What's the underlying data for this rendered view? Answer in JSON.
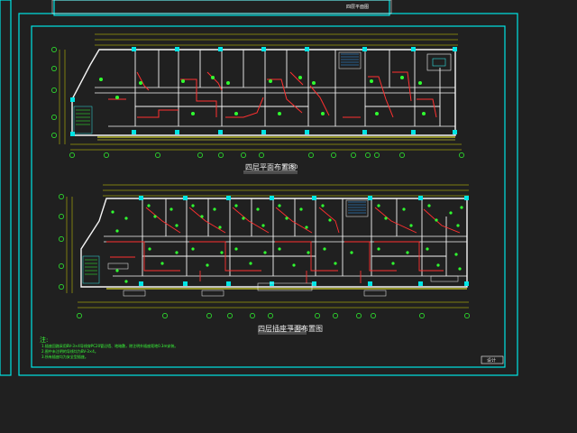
{
  "drawing": {
    "plan_upper_title": "四层平面布置图",
    "plan_upper_scale": "1:150",
    "plan_lower_title": "四层插座平面布置图",
    "plan_lower_scale": "1:150",
    "notes_heading": "注:",
    "notes_lines": [
      "1.插座回路采用BV-3×4导线穿PC20管沿墙、地暗敷，除注明外插座距地0.3m安装。",
      "2.图中未注明的导线均为BV-3×4。",
      "3.所有插座均为安全型插座。"
    ],
    "sheet_top_label": "四层平面图",
    "corner_stamp": "设计"
  },
  "colors": {
    "frame": "#00e5e5",
    "wall": "#f5f5f5",
    "wire": "#ff3030",
    "fixture": "#30ff30",
    "dimension": "#d8d800",
    "axis": "#00ff40",
    "background": "#202020"
  }
}
